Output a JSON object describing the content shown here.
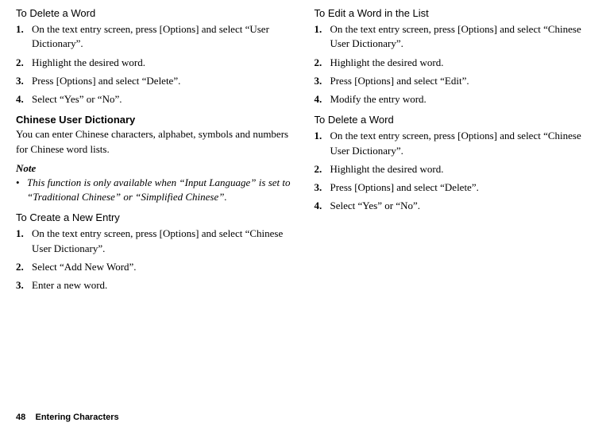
{
  "left": {
    "delete_heading": "To Delete a Word",
    "delete_steps": [
      "On the text entry screen, press [Options] and select “User Dictionary”.",
      "Highlight the desired word.",
      "Press [Options] and select “Delete”.",
      "Select “Yes” or “No”."
    ],
    "cud_heading": "Chinese User Dictionary",
    "cud_body": "You can enter Chinese characters, alphabet, symbols and numbers for Chinese word lists.",
    "note_label": "Note",
    "note_text": "This function is only available when “Input Language” is set to “Traditional Chinese” or “Simplified Chinese”.",
    "create_heading": "To Create a New Entry",
    "create_steps": [
      "On the text entry screen, press [Options] and select “Chinese User Dictionary”.",
      "Select “Add New Word”.",
      "Enter a new word."
    ]
  },
  "right": {
    "edit_heading": "To Edit a Word in the List",
    "edit_steps": [
      "On the text entry screen, press [Options] and select “Chinese User Dictionary”.",
      "Highlight the desired word.",
      "Press [Options] and select “Edit”.",
      "Modify the entry word."
    ],
    "delete2_heading": "To Delete a Word",
    "delete2_steps": [
      "On the text entry screen, press [Options] and select “Chinese User Dictionary”.",
      "Highlight the desired word.",
      "Press [Options] and select “Delete”.",
      "Select “Yes” or “No”."
    ]
  },
  "footer": {
    "page_num": "48",
    "section": "Entering Characters"
  }
}
